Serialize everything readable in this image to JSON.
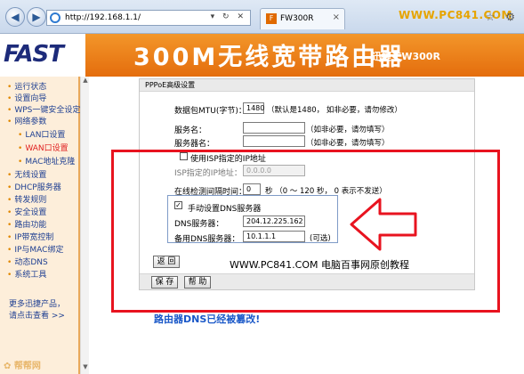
{
  "browser": {
    "url": "http://192.168.1.1/",
    "addr_tools": "▾ ↻ ✕",
    "tab_title": "FW300R",
    "tab_icon": "F",
    "tab_close": "×",
    "watermark": "WWW.PC841.COM",
    "window_icons": "☆ ⚙",
    "back_icon": "◀",
    "forward_icon": "▶"
  },
  "header": {
    "logo": "FAST",
    "title": "300M无线宽带路由器",
    "model": "迅捷 FW300R",
    "brand_color": "#E8781A"
  },
  "sidebar": {
    "items": [
      {
        "label": "运行状态"
      },
      {
        "label": "设置向导"
      },
      {
        "label": "WPS一键安全设定"
      },
      {
        "label": "网络参数"
      },
      {
        "label": "LAN口设置"
      },
      {
        "label": "WAN口设置"
      },
      {
        "label": "MAC地址克隆"
      },
      {
        "label": "无线设置"
      },
      {
        "label": "DHCP服务器"
      },
      {
        "label": "转发规则"
      },
      {
        "label": "安全设置"
      },
      {
        "label": "路由功能"
      },
      {
        "label": "IP带宽控制"
      },
      {
        "label": "IP与MAC绑定"
      },
      {
        "label": "动态DNS"
      },
      {
        "label": "系统工具"
      }
    ],
    "more_line1": "更多迅捷产品，",
    "more_line2": "请点击查看 >>"
  },
  "panel": {
    "title": "PPPoE高级设置",
    "mtu_label": "数据包MTU(字节)：",
    "mtu_value": "1480",
    "mtu_hint": "（默认是1480， 如非必要，请勿修改）",
    "service_name_label": "服务名：",
    "service_name_value": "",
    "service_name_hint": "（如非必要，请勿填写）",
    "server_name_label": "服务器名：",
    "server_name_value": "",
    "server_name_hint": "（如非必要，请勿填写）",
    "isp_ip_check_label": "使用ISP指定的IP地址",
    "isp_ip_label": "ISP指定的IP地址：",
    "isp_ip_value": "0.0.0.0",
    "interval_label": "在线检测间隔时间：",
    "interval_value": "0",
    "interval_hint": "秒 （0 ～ 120 秒， 0 表示不发送）",
    "dns_check_label": "手动设置DNS服务器",
    "dns_checked_mark": "✓",
    "dns_label": "DNS服务器：",
    "dns_value": "204.12.225.162",
    "dns2_label": "备用DNS服务器：",
    "dns2_value": "10.1.1.1",
    "dns2_hint": "(可选)",
    "back_button": "返 回",
    "save_button": "保 存",
    "help_button": "帮 助"
  },
  "annotations": {
    "watermark_middle": "WWW.PC841.COM 电脑百事网原创教程",
    "caption": "路由器DNS已经被篡改!",
    "highlight_color": "#E8131F"
  },
  "sidebar_bottom_logo": "✿ 帮帮网"
}
